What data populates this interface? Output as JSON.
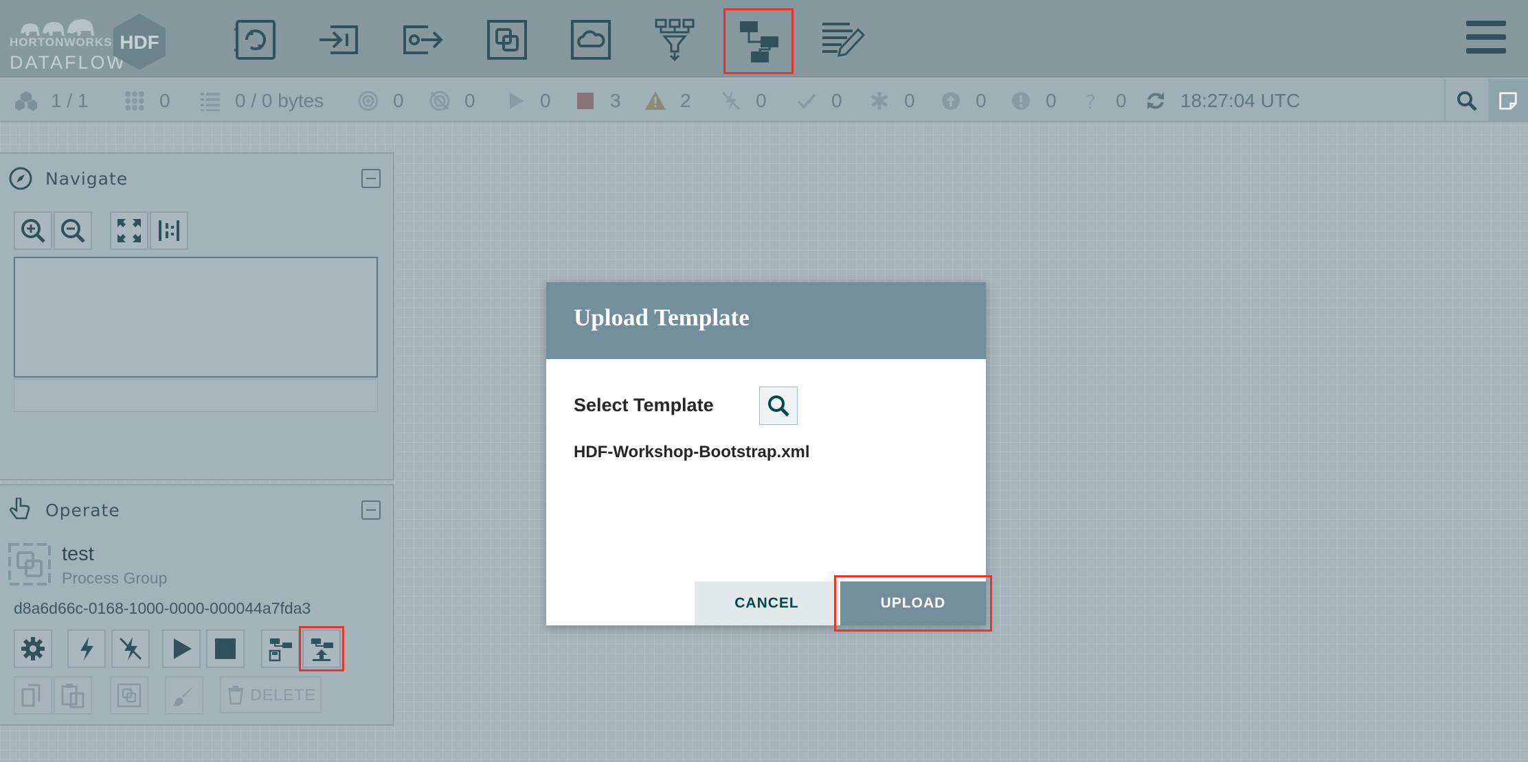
{
  "brand": {
    "company": "HORTONWORKS",
    "product": "DATAFLOW",
    "badge": "HDF"
  },
  "toolbar": {
    "items": [
      {
        "name": "processor",
        "icon": "processor-icon"
      },
      {
        "name": "input-port",
        "icon": "input-port-icon"
      },
      {
        "name": "output-port",
        "icon": "output-port-icon"
      },
      {
        "name": "process-group",
        "icon": "process-group-icon"
      },
      {
        "name": "remote-process-group",
        "icon": "remote-process-group-icon"
      },
      {
        "name": "funnel",
        "icon": "funnel-icon"
      },
      {
        "name": "template",
        "icon": "template-icon",
        "highlighted": true
      },
      {
        "name": "label",
        "icon": "label-icon"
      }
    ]
  },
  "status": {
    "transmitting": "1 / 1",
    "queued_count": "0",
    "queued_bytes": "0 / 0 bytes",
    "transmitting_remote": "0",
    "not_transmitting_remote": "0",
    "running": "0",
    "stopped": "3",
    "invalid": "2",
    "disabled": "0",
    "up_to_date": "0",
    "locally_modified": "0",
    "stale": "0",
    "locally_modified_and_stale": "0",
    "sync_failure": "0",
    "last_refreshed": "18:27:04 UTC"
  },
  "navigate": {
    "title": "Navigate"
  },
  "operate": {
    "title": "Operate",
    "component_name": "test",
    "component_type": "Process Group",
    "component_id": "d8a6d66c-0168-1000-0000-000044a7fda3",
    "delete_label": "DELETE"
  },
  "dialog": {
    "title": "Upload Template",
    "select_label": "Select Template",
    "selected_file": "HDF-Workshop-Bootstrap.xml",
    "cancel_label": "CANCEL",
    "upload_label": "UPLOAD"
  },
  "colors": {
    "accent": "#728e9b",
    "highlight": "#e8342a",
    "cancel_text": "#004849"
  }
}
